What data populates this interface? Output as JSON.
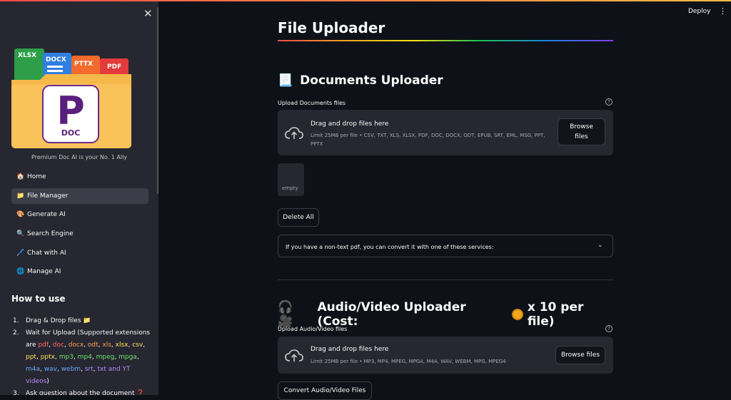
{
  "header": {
    "deploy_label": "Deploy",
    "menu_icon": "kebab-icon"
  },
  "sidebar": {
    "close_icon": "close-icon",
    "logo": {
      "tags": [
        "XLSX",
        "DOCX",
        "PTTX",
        "PDF"
      ],
      "brand_letter": "P",
      "brand_text": "DOC"
    },
    "tagline": "Premium Doc AI is your No. 1 Ally",
    "nav": [
      {
        "icon": "🏠",
        "label": "Home"
      },
      {
        "icon": "📁",
        "label": "File Manager",
        "active": true
      },
      {
        "icon": "🎨",
        "label": "Generate AI"
      },
      {
        "icon": "🔍",
        "label": "Search Engine"
      },
      {
        "icon": "🖊️",
        "label": "Chat with AI"
      },
      {
        "icon": "🌐",
        "label": "Manage AI"
      }
    ],
    "howto_title": "How to use",
    "steps": {
      "s1": "Drag & Drop files 📁",
      "s2_prefix": "Wait for Upload (Supported extensions are",
      "s2_ext": [
        "pdf",
        "doc",
        "docx",
        "odt",
        "xls",
        "xlsx",
        "csv",
        "ppt",
        "pptx",
        "mp3",
        "mp4",
        "mpeg",
        "mpga",
        "m4a",
        "wav",
        "webm",
        "srt",
        "txt",
        "YT videos"
      ],
      "s2_and": "and",
      "s3": "Ask question about the document ❓"
    }
  },
  "main": {
    "title": "File Uploader",
    "documents": {
      "heading_icon": "📃",
      "heading": "Documents Uploader",
      "label": "Upload Documents files",
      "dz_title": "Drag and drop files here",
      "dz_limit": "Limit 25MB per file • CSV, TXT, XLS, XLSX, PDF, DOC, DOCX, ODT, EPUB, SRT, EML, MSG, PPT, PPTX",
      "browse_line1": "Browse",
      "browse_line2": "files",
      "empty_label": "empty",
      "delete_all": "Delete All",
      "expander_text": "If you have a non-text pdf, you can convert it with one of these services:"
    },
    "audio": {
      "heading_icons": "🎧 🎥",
      "heading": "Audio/Video Uploader (Cost:",
      "heading_suffix": "x 10 per file)",
      "label": "Upload Audio/Video files",
      "dz_title": "Drag and drop files here",
      "dz_limit": "Limit 25MB per file • MP3, MP4, MPEG, MPGA, M4A, WAV, WEBM, MPG, MPEG4",
      "browse": "Browse files",
      "convert": "Convert Audio/Video Files"
    }
  }
}
